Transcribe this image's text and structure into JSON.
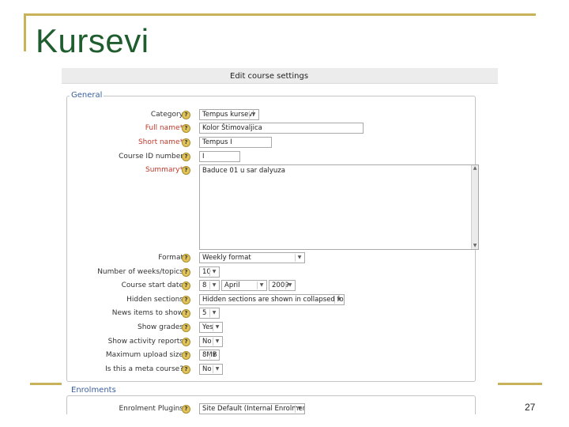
{
  "slide": {
    "title": "Kursevi",
    "page_number": "27"
  },
  "screenshot": {
    "header_title": "Edit course settings",
    "sections": {
      "general": "General",
      "enrolments": "Enrolments"
    },
    "help_glyph": "?",
    "fields": {
      "category": {
        "label": "Category",
        "value": "Tempus kursevi"
      },
      "fullname": {
        "label": "Full name*",
        "value": "Kolor Štimovaljica"
      },
      "shortname": {
        "label": "Short name*",
        "value": "Tempus I"
      },
      "idnumber": {
        "label": "Course ID number",
        "value": "I"
      },
      "summary": {
        "label": "Summary*",
        "value": "Baduce 01 u sar dalyuza"
      },
      "format": {
        "label": "Format",
        "value": "Weekly format"
      },
      "numsections": {
        "label": "Number of weeks/topics",
        "value": "10"
      },
      "startdate": {
        "label": "Course start date",
        "day": "8",
        "month": "April",
        "year": "2009"
      },
      "hiddensections": {
        "label": "Hidden sections",
        "value": "Hidden sections are shown in collapsed form"
      },
      "newsitems": {
        "label": "News items to show",
        "value": "5"
      },
      "showgrades": {
        "label": "Show grades",
        "value": "Yes"
      },
      "showreports": {
        "label": "Show activity reports",
        "value": "No"
      },
      "maxbytes": {
        "label": "Maximum upload size",
        "value": "8MB"
      },
      "metacourse": {
        "label": "Is this a meta course?",
        "value": "No"
      },
      "enrol": {
        "label": "Enrolment Plugins",
        "value": "Site Default (Internal Enrolment)"
      }
    }
  },
  "icons": {
    "dropdown": "chevron-down-icon",
    "help": "help-icon"
  },
  "colors": {
    "slide_title": "#1f5d2e",
    "slide_rule": "#c8b25a",
    "legend": "#3a5fa0",
    "required_label": "#c0392b"
  }
}
